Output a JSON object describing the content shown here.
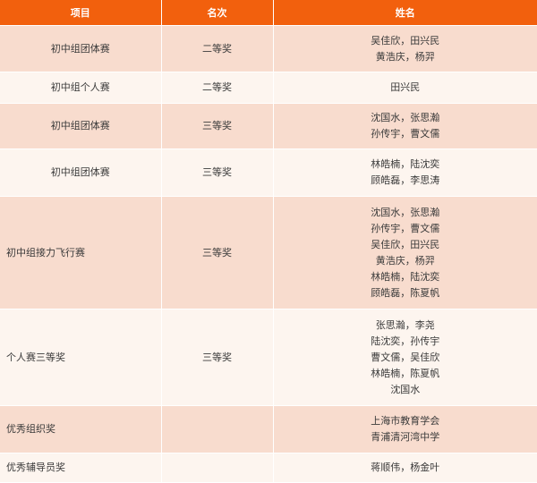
{
  "header": {
    "col_item": "项目",
    "col_rank": "名次",
    "col_name": "姓名"
  },
  "rows": [
    {
      "item": "初中组团体赛",
      "rank": "二等奖",
      "names": [
        "吴佳欣，田兴民",
        "黄浩庆，杨羿"
      ]
    },
    {
      "item": "初中组个人赛",
      "rank": "二等奖",
      "names": [
        "田兴民"
      ]
    },
    {
      "item": "初中组团体赛",
      "rank": "三等奖",
      "names": [
        "沈国水，张思瀚",
        "孙传宇，曹文儒"
      ]
    },
    {
      "item": "初中组团体赛",
      "rank": "三等奖",
      "names": [
        "林皓楠，陆沈奕",
        "顾皓磊，李思涛"
      ]
    },
    {
      "item": "初中组接力飞行赛",
      "rank": "三等奖",
      "names": [
        "沈国水，张思瀚",
        "孙传宇，曹文儒",
        "吴佳欣，田兴民",
        "黄浩庆，杨羿",
        "林皓楠，陆沈奕",
        "顾皓磊，陈夏帆"
      ]
    },
    {
      "item": "个人赛三等奖",
      "rank": "三等奖",
      "names": [
        "张思瀚，李尧",
        "陆沈奕，孙传宇",
        "曹文儒，吴佳欣",
        "林皓楠，陈夏帆",
        "沈国水"
      ]
    },
    {
      "item": "优秀组织奖",
      "rank": "",
      "names": [
        "上海市教育学会",
        "青浦清河湾中学"
      ]
    },
    {
      "item": "优秀辅导员奖",
      "rank": "",
      "names": [
        "蒋顺伟，杨金叶"
      ]
    }
  ]
}
